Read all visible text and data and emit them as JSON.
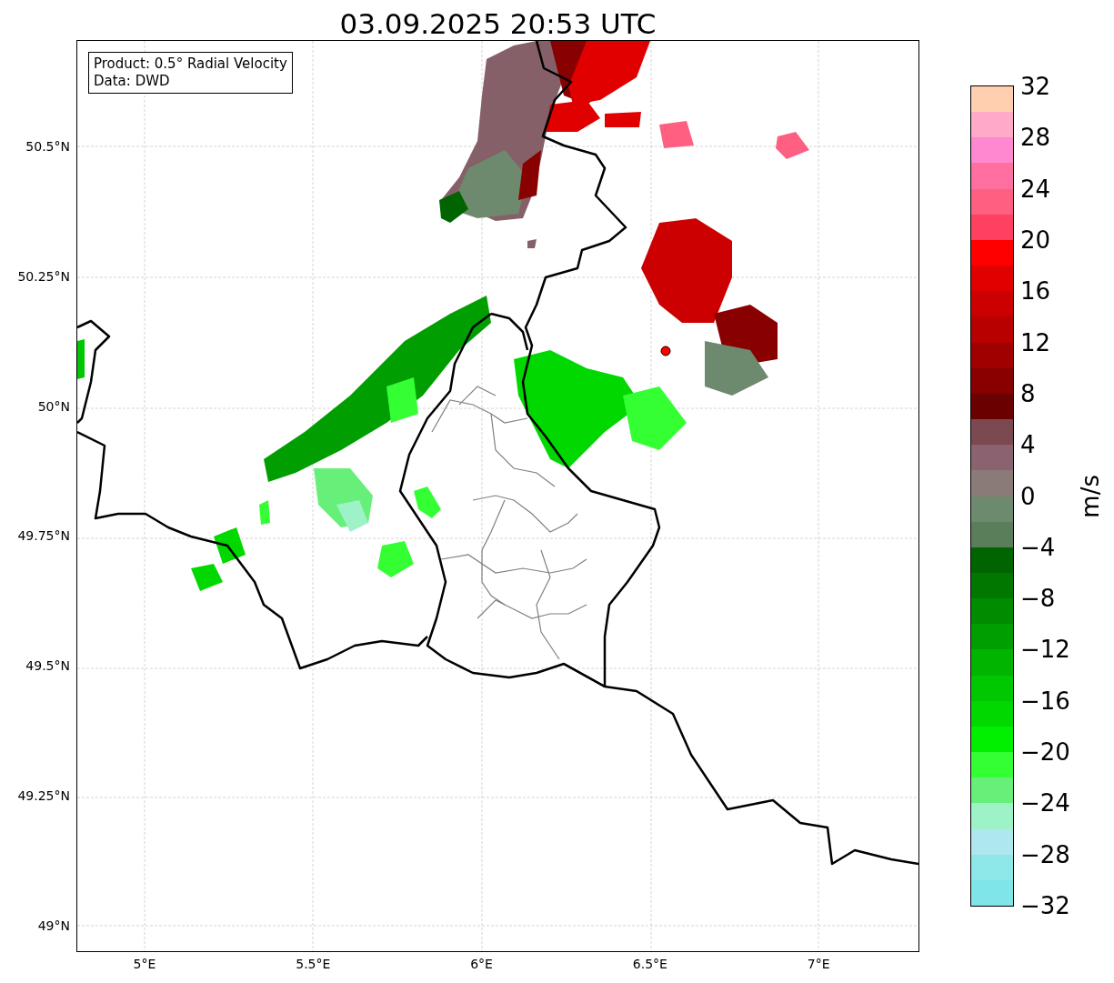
{
  "title": "03.09.2025 20:53 UTC",
  "info_box": {
    "lines": [
      "Product: 0.5° Radial Velocity",
      "Data: DWD"
    ]
  },
  "map": {
    "yticks": [
      "50.5°N",
      "50.25°N",
      "50°N",
      "49.75°N",
      "49.5°N",
      "49.25°N",
      "49°N"
    ],
    "xticks": [
      "5°E",
      "5.5°E",
      "6°E",
      "6.5°E",
      "7°E"
    ]
  },
  "colorbar": {
    "label": "m/s",
    "ticks": [
      "32",
      "28",
      "24",
      "20",
      "16",
      "12",
      "8",
      "4",
      "0",
      "−4",
      "−8",
      "−12",
      "−16",
      "−20",
      "−24",
      "−28",
      "−32"
    ],
    "bands": [
      {
        "color": "#ffcfb0"
      },
      {
        "color": "#ffaac8"
      },
      {
        "color": "#ff88d0"
      },
      {
        "color": "#ff70a0"
      },
      {
        "color": "#ff5f80"
      },
      {
        "color": "#ff4060"
      },
      {
        "color": "#ff0000"
      },
      {
        "color": "#e00000"
      },
      {
        "color": "#cc0000"
      },
      {
        "color": "#b80000"
      },
      {
        "color": "#a00000"
      },
      {
        "color": "#880000"
      },
      {
        "color": "#6a0000"
      },
      {
        "color": "#7a4a50"
      },
      {
        "color": "#8a6270"
      },
      {
        "color": "#8a7a78"
      },
      {
        "color": "#6e8a6e"
      },
      {
        "color": "#5a7e5a"
      },
      {
        "color": "#006400"
      },
      {
        "color": "#007800"
      },
      {
        "color": "#008c00"
      },
      {
        "color": "#009e00"
      },
      {
        "color": "#00b400"
      },
      {
        "color": "#00c800"
      },
      {
        "color": "#00d800"
      },
      {
        "color": "#00f000"
      },
      {
        "color": "#33ff33"
      },
      {
        "color": "#66f07a"
      },
      {
        "color": "#9ef2c8"
      },
      {
        "color": "#aee8ee"
      },
      {
        "color": "#8ee8ea"
      },
      {
        "color": "#7fe5e8"
      }
    ]
  }
}
